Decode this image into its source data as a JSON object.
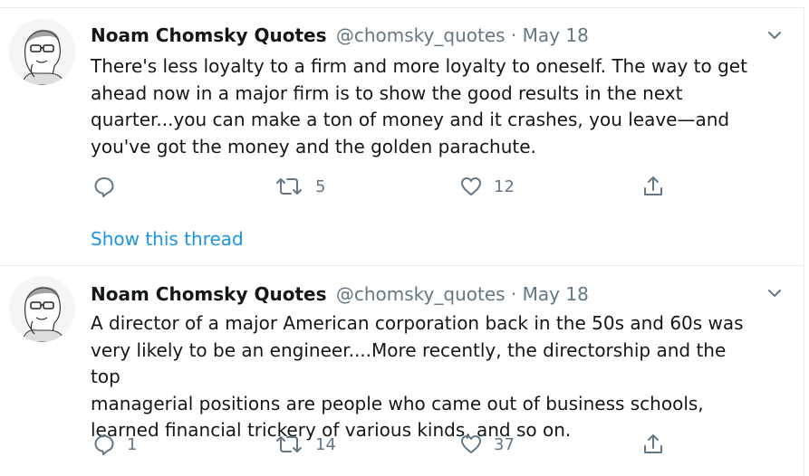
{
  "tweets": [
    {
      "name": "Noam Chomsky Quotes",
      "handle": "@chomsky_quotes",
      "separator": "·",
      "date": "May 18",
      "lines": [
        "There's less loyalty to a firm and more loyalty to oneself. The way to get",
        "ahead now in a major firm is to show the good results in the next",
        "quarter...you can make a ton of money and it crashes, you leave—and",
        "you've got the money and the golden parachute."
      ],
      "replies": "",
      "retweets": "5",
      "likes": "12",
      "thread_link": "Show this thread"
    },
    {
      "name": "Noam Chomsky Quotes",
      "handle": "@chomsky_quotes",
      "separator": "·",
      "date": "May 18",
      "lines": [
        "A director of a major American corporation back in the 50s and 60s was",
        "very likely to be an engineer....More recently, the directorship and the top",
        "managerial positions are people who came out of business schools,",
        "learned financial trickery of various kinds, and so on."
      ],
      "replies": "1",
      "retweets": "14",
      "likes": "37"
    }
  ],
  "icons": {
    "reply": "reply-icon",
    "retweet": "retweet-icon",
    "like": "heart-icon",
    "share": "share-icon",
    "caret": "chevron-down-icon",
    "avatar": "avatar-illustration"
  },
  "colors": {
    "text": "#14171a",
    "muted": "#657786",
    "link": "#1b95e0",
    "border": "#e6ecf0"
  }
}
